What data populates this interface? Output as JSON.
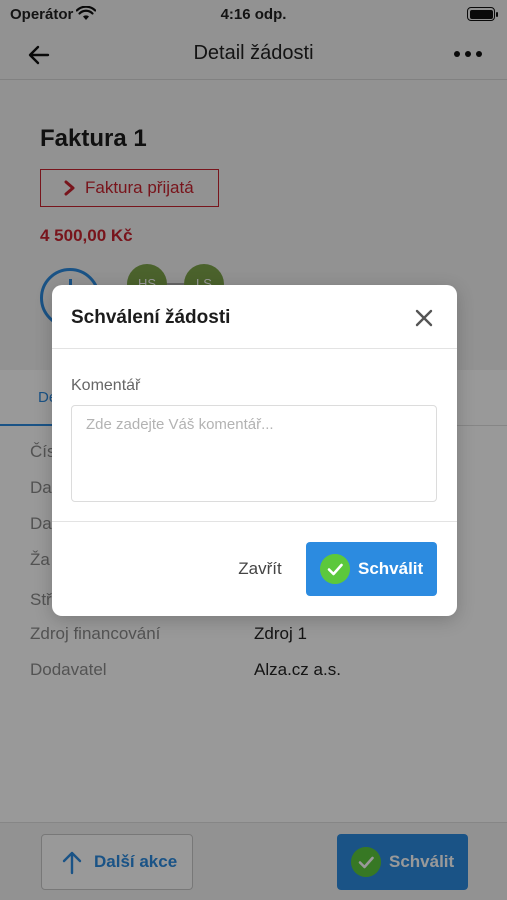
{
  "status_bar": {
    "carrier": "Operátor",
    "time": "4:16 odp."
  },
  "nav": {
    "title": "Detail žádosti",
    "back_icon": "arrow-left-icon",
    "more_icon": "more-horizontal-icon"
  },
  "header": {
    "title": "Faktura 1",
    "status": "Faktura přijatá",
    "amount": "4 500,00 Kč",
    "avatars": [
      "HS",
      "LS"
    ]
  },
  "tabs": {
    "active": "De"
  },
  "details": {
    "rows": [
      {
        "label": "Čís",
        "value": ""
      },
      {
        "label": "Da",
        "value": ""
      },
      {
        "label": "Da",
        "value": ""
      },
      {
        "label": "Ža",
        "value": ""
      },
      {
        "label": "Stř",
        "value": ""
      },
      {
        "label": "Zdroj financování",
        "value": "Zdroj 1"
      },
      {
        "label": "Dodavatel",
        "value": "Alza.cz a.s."
      }
    ]
  },
  "bottom_bar": {
    "more_actions": "Další akce",
    "approve": "Schválit"
  },
  "modal": {
    "title": "Schválení žádosti",
    "comment_label": "Komentář",
    "comment_placeholder": "Zde zadejte Váš komentář...",
    "comment_value": "",
    "close": "Zavřít",
    "approve": "Schválit"
  },
  "colors": {
    "accent": "#2c8be0",
    "danger": "#c9232f",
    "success": "#5cc83c",
    "avatar": "#7da34a"
  }
}
